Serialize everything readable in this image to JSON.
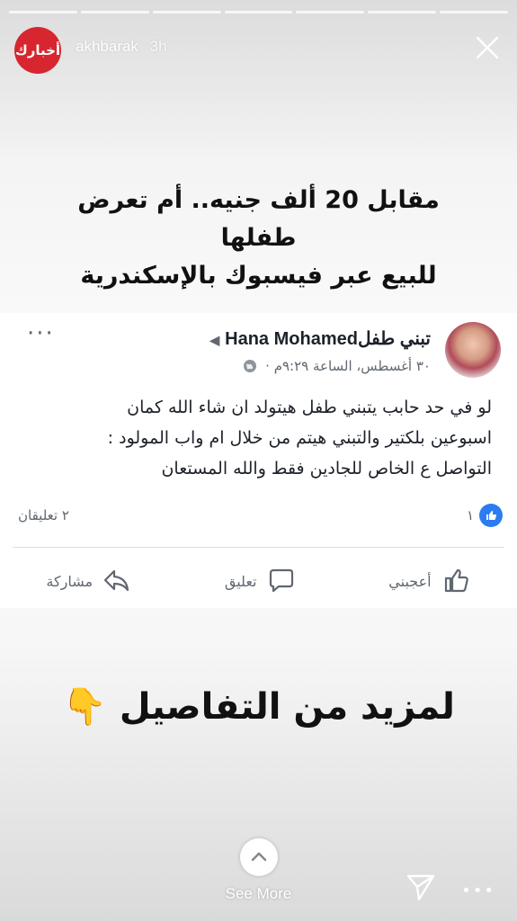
{
  "story": {
    "segments": 7,
    "username": "akhbarak",
    "age": "3h",
    "avatar_text": "أخبارك",
    "accent": "#d7262f"
  },
  "headline": {
    "line1": "مقابل 20 ألف جنيه.. أم تعرض طفلها",
    "line2": "للبيع عبر فيسبوك بالإسكندرية"
  },
  "post": {
    "author": "Hana Mohamed",
    "group": "تبني طفل",
    "meta": "٣٠ أغسطس، الساعة ٩:٢٩م ·",
    "body": [
      "لو في حد حابب يتبني طفل هيتولد ان شاء الله كمان",
      "اسبوعين بلكتير والتبني هيتم من خلال ام واب المولود :",
      "التواصل ع الخاص للجادين فقط والله المستعان"
    ],
    "likes_count": "١",
    "comments_count": "٢ تعليقان",
    "actions": {
      "like": "أعجبني",
      "comment": "تعليق",
      "share": "مشاركة"
    },
    "like_color": "#2d7bf0"
  },
  "cta": {
    "text": "لمزيد من التفاصيل",
    "emoji": "👇"
  },
  "footer": {
    "see_more": "See More"
  },
  "icons": [
    "close-icon",
    "globe-icon",
    "like-icon",
    "comment-icon",
    "share-icon",
    "chevron-up-icon",
    "send-icon",
    "more-icon"
  ]
}
